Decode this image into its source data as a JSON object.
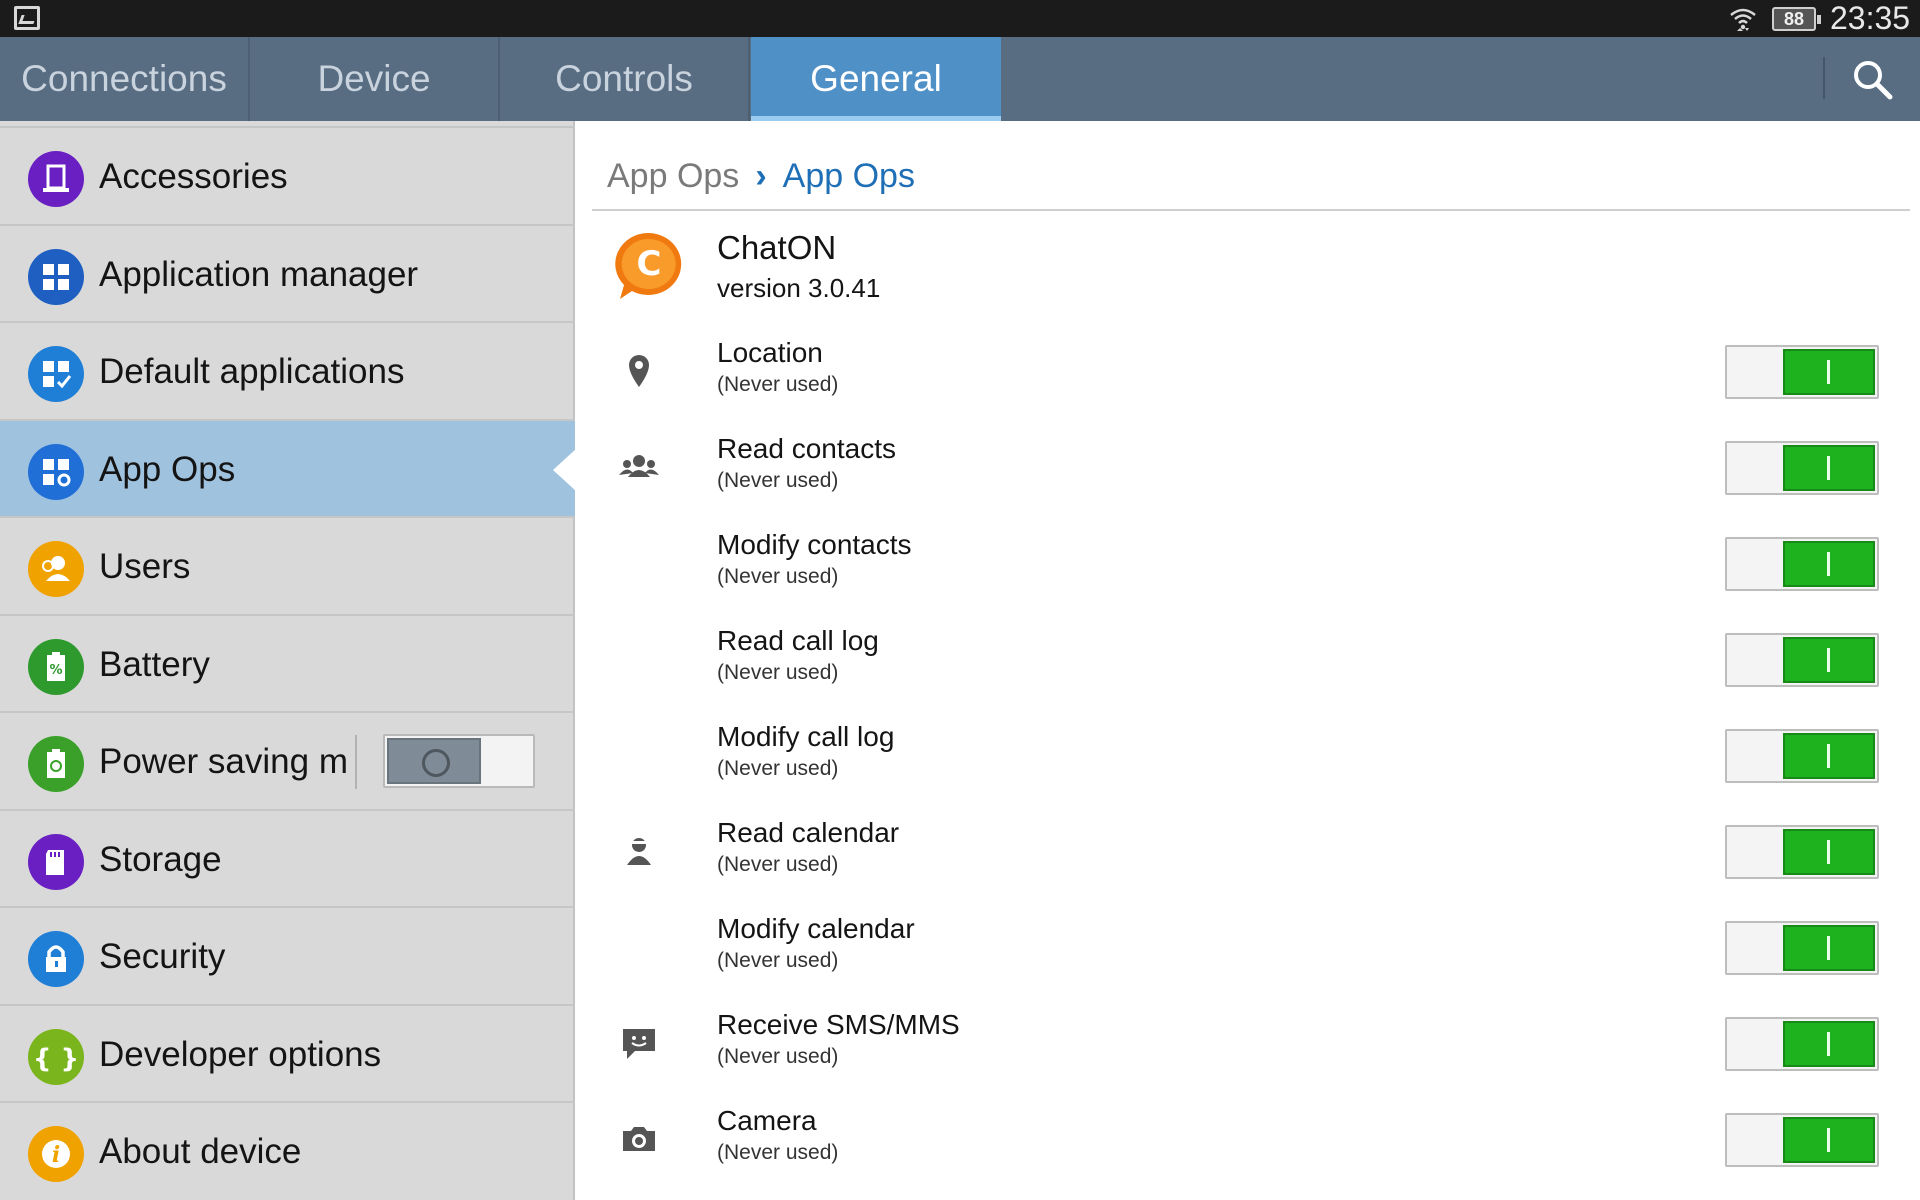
{
  "status_bar": {
    "time": "23:35",
    "battery_level": "88",
    "icons": [
      "gallery-icon",
      "wifi-icon",
      "battery-icon"
    ]
  },
  "tabs": [
    {
      "label": "Connections",
      "active": false
    },
    {
      "label": "Device",
      "active": false
    },
    {
      "label": "Controls",
      "active": false
    },
    {
      "label": "General",
      "active": true
    }
  ],
  "sidebar": {
    "items": [
      {
        "label": "Accessories",
        "icon": "accessories-icon",
        "color": "#6a1fc2"
      },
      {
        "label": "Application manager",
        "icon": "grid-icon",
        "color": "#1f5fc2"
      },
      {
        "label": "Default applications",
        "icon": "grid-check-icon",
        "color": "#1f7fd6"
      },
      {
        "label": "App Ops",
        "icon": "grid-gear-icon",
        "color": "#1f6fd6",
        "selected": true
      },
      {
        "label": "Users",
        "icon": "users-icon",
        "color": "#f0a300"
      },
      {
        "label": "Battery",
        "icon": "battery-percent-icon",
        "color": "#2e9a2e"
      },
      {
        "label": "Power saving mc",
        "icon": "power-saving-icon",
        "color": "#3aa02a",
        "toggle": false
      },
      {
        "label": "Storage",
        "icon": "sd-card-icon",
        "color": "#6a1fc2"
      },
      {
        "label": "Security",
        "icon": "lock-icon",
        "color": "#1f7fd6"
      },
      {
        "label": "Developer options",
        "icon": "braces-icon",
        "color": "#7ab51d"
      },
      {
        "label": "About device",
        "icon": "info-icon",
        "color": "#f0a300"
      }
    ]
  },
  "breadcrumb": {
    "parent": "App Ops",
    "current": "App Ops"
  },
  "app": {
    "name": "ChatON",
    "version": "version 3.0.41",
    "logo_color": "#f07a10"
  },
  "permissions": [
    {
      "title": "Location",
      "subtitle": "(Never used)",
      "icon": "location-pin-icon",
      "enabled": true
    },
    {
      "title": "Read contacts",
      "subtitle": "(Never used)",
      "icon": "contacts-group-icon",
      "enabled": true
    },
    {
      "title": "Modify contacts",
      "subtitle": "(Never used)",
      "icon": "",
      "enabled": true
    },
    {
      "title": "Read call log",
      "subtitle": "(Never used)",
      "icon": "",
      "enabled": true
    },
    {
      "title": "Modify call log",
      "subtitle": "(Never used)",
      "icon": "",
      "enabled": true
    },
    {
      "title": "Read calendar",
      "subtitle": "(Never used)",
      "icon": "person-icon",
      "enabled": true
    },
    {
      "title": "Modify calendar",
      "subtitle": "(Never used)",
      "icon": "",
      "enabled": true
    },
    {
      "title": "Receive SMS/MMS",
      "subtitle": "(Never used)",
      "icon": "message-icon",
      "enabled": true
    },
    {
      "title": "Camera",
      "subtitle": "(Never used)",
      "icon": "camera-icon",
      "enabled": true
    }
  ],
  "colors": {
    "tab_bar": "#586c82",
    "tab_active": "#4f90c7",
    "sidebar_bg": "#d9d9d9",
    "sidebar_selected": "#9fc2df",
    "accent_blue": "#1f6fb6",
    "switch_on": "#1fb21f"
  }
}
